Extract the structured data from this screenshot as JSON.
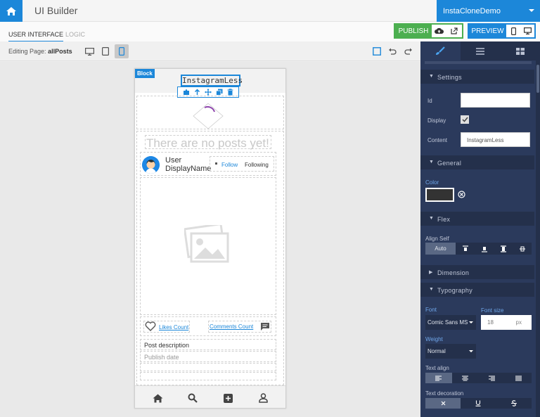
{
  "app": {
    "title": "UI Builder",
    "project": "InstaCloneDemo"
  },
  "nav": {
    "tab_ui": "USER INTERFACE",
    "tab_logic": "LOGIC"
  },
  "actions": {
    "publish": "PUBLISH",
    "preview": "PREVIEW"
  },
  "editbar": {
    "editing_prefix": "Editing Page:",
    "page_name": "allPosts"
  },
  "canvas": {
    "block_tag": "Block",
    "title": "InstagramLess",
    "empty_message": "There are no posts yet!",
    "user_name_line1": "User",
    "user_name_line2": "DisplayName",
    "follow": "Follow",
    "following": "Following",
    "likes_count": "Likes Count",
    "comments_count": "Comments Count",
    "post_description": "Post description",
    "publish_date": "Publish date"
  },
  "panel": {
    "sections": {
      "settings": "Settings",
      "general": "General",
      "flex": "Flex",
      "dimension": "Dimension",
      "typography": "Typography"
    },
    "labels": {
      "id": "Id",
      "display": "Display",
      "content": "Content",
      "color": "Color",
      "align_self": "Align Self",
      "font": "Font",
      "font_size": "Font size",
      "weight": "Weight",
      "text_align": "Text align",
      "text_decoration": "Text decoration"
    },
    "values": {
      "id": "",
      "content": "InstagramLess",
      "align_self": "Auto",
      "font": "Comic Sans MS",
      "font_size": "18",
      "font_size_unit": "px",
      "weight": "Normal"
    },
    "colors": {
      "swatch": "#333333"
    }
  },
  "colors": {
    "accent": "#1c87d9",
    "publish": "#4caf50",
    "panel_bg": "#2b3a5c"
  },
  "icons": [
    "home-icon",
    "cloud-upload-icon",
    "external-link-icon",
    "mobile-icon",
    "desktop-icon",
    "tablet-icon",
    "undo-icon",
    "redo-icon",
    "brush-icon",
    "menu-icon",
    "grid-icon",
    "image-icon",
    "heart-icon",
    "comment-icon",
    "search-icon",
    "plus-square-icon",
    "user-icon"
  ]
}
